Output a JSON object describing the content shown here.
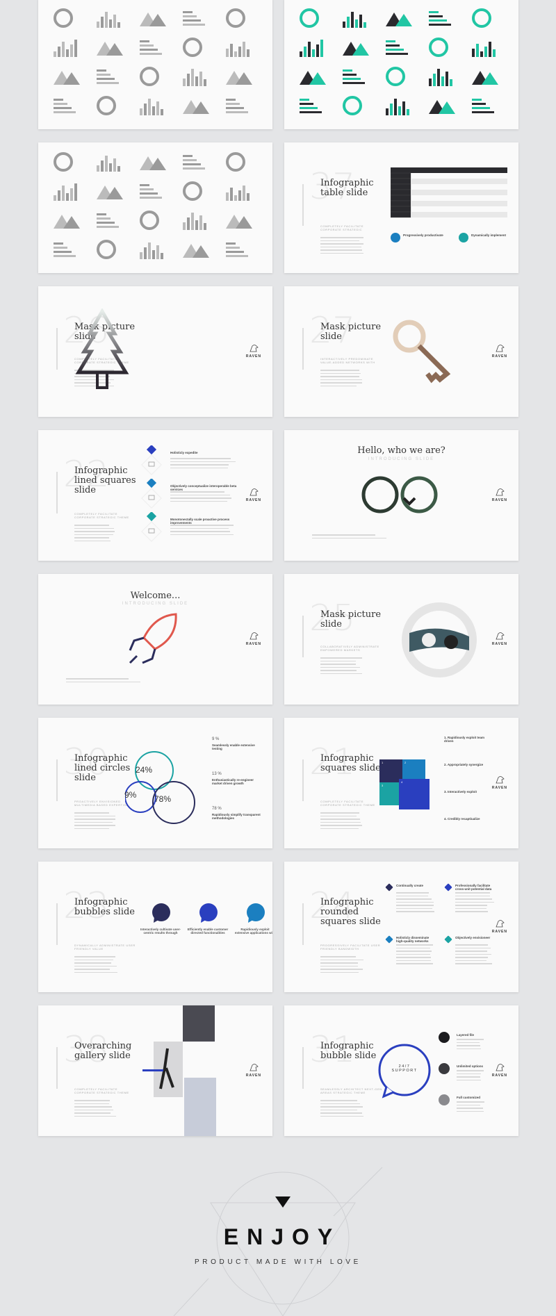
{
  "brand": "RAVEN",
  "colors": {
    "navy": "#2b2d5c",
    "blue": "#2a3fbf",
    "sky": "#1b7fc0",
    "teal": "#1ba3a3",
    "dark": "#2a2a2e",
    "mint": "#21c6a4"
  },
  "slides": [
    {
      "type": "icons-grey"
    },
    {
      "type": "icons-teal"
    },
    {
      "type": "charts-3d"
    },
    {
      "type": "table",
      "number": "37",
      "title": "Infographic table slide",
      "subtitle": "Completely facilitate corporate strategic",
      "features": [
        "Progressively productivate",
        "Dynamically implement"
      ]
    },
    {
      "type": "mask-tree",
      "number": "26",
      "title": "Mask picture slide",
      "subtitle": "Completely facilitate corporate strategic theme"
    },
    {
      "type": "mask-key",
      "number": "27",
      "title": "Mask picture slide",
      "subtitle": "Interactively predominate value-added networks with"
    },
    {
      "type": "lined-squares",
      "number": "22",
      "title": "Infographic lined squares slide",
      "subtitle": "Completely facilitate corporate strategic theme",
      "items": [
        "Holisticly expedite",
        "Objectively conceptualize interoperable beta services",
        "Monotonectally scale proactive process improvements"
      ]
    },
    {
      "type": "hello",
      "heading": "Hello, who we are?",
      "tagline": "INTRODUCING SLIDE"
    },
    {
      "type": "welcome",
      "heading": "Welcome...",
      "tagline": "INTRODUCING SLIDE"
    },
    {
      "type": "mask-circle",
      "number": "25",
      "title": "Mask picture slide",
      "subtitle": "Collaboratively administrate empowered markets"
    },
    {
      "type": "circles",
      "number": "30",
      "title": "Infographic lined circles slide",
      "subtitle": "Proactively envisioned multimedia based expertise",
      "values": [
        "24%",
        "9%",
        "78%"
      ],
      "stats": [
        {
          "value": "9 %",
          "label": "Seamlessly enable extensive testing"
        },
        {
          "value": "13 %",
          "label": "Enthusiastically re-engineer market driven growth"
        },
        {
          "value": "78 %",
          "label": "Rapidiously simplify transparent methodologies"
        }
      ]
    },
    {
      "type": "squares",
      "number": "21",
      "title": "Infographic squares slide",
      "subtitle": "Completely facilitate corporate strategic theme",
      "items": [
        "1. Rapidiously exploit team driven",
        "2. Appropriately synergize",
        "3. Interactively exploit",
        "4. Credibly recaptiualize"
      ],
      "tiles": [
        "1",
        "2",
        "3",
        "4"
      ]
    },
    {
      "type": "bubbles",
      "number": "23",
      "title": "Infographic bubbles slide",
      "subtitle": "Dynamically administrate user friendly value",
      "items": [
        "Interactively cultivate user-centric results through",
        "Efficiently enable customer directed functionalities",
        "Rapidiously exploit extensive applications with"
      ]
    },
    {
      "type": "rounded",
      "number": "24",
      "title": "Infographic rounded squares slide",
      "subtitle": "Progressively facilitate user friendly bandwidth",
      "items": [
        "Continually create",
        "Professionally facilitate cross-unit potential data",
        "Holisticly disseminate high-quality networks",
        "Objectively envisioneer"
      ]
    },
    {
      "type": "gallery",
      "number": "38",
      "title": "Overarching gallery slide",
      "subtitle": "Completely facilitate corporate strategic theme"
    },
    {
      "type": "bubble",
      "number": "31",
      "title": "Infographic bubble slide",
      "subtitle": "Seamlessly architect next-gen areas strategic theme",
      "support": "24/7 SUPPORT",
      "items": [
        "Layered file",
        "Unlimited options",
        "Full customized"
      ]
    }
  ],
  "footer": {
    "title": "ENJOY",
    "tagline": "PRODUCT MADE WITH LOVE"
  }
}
